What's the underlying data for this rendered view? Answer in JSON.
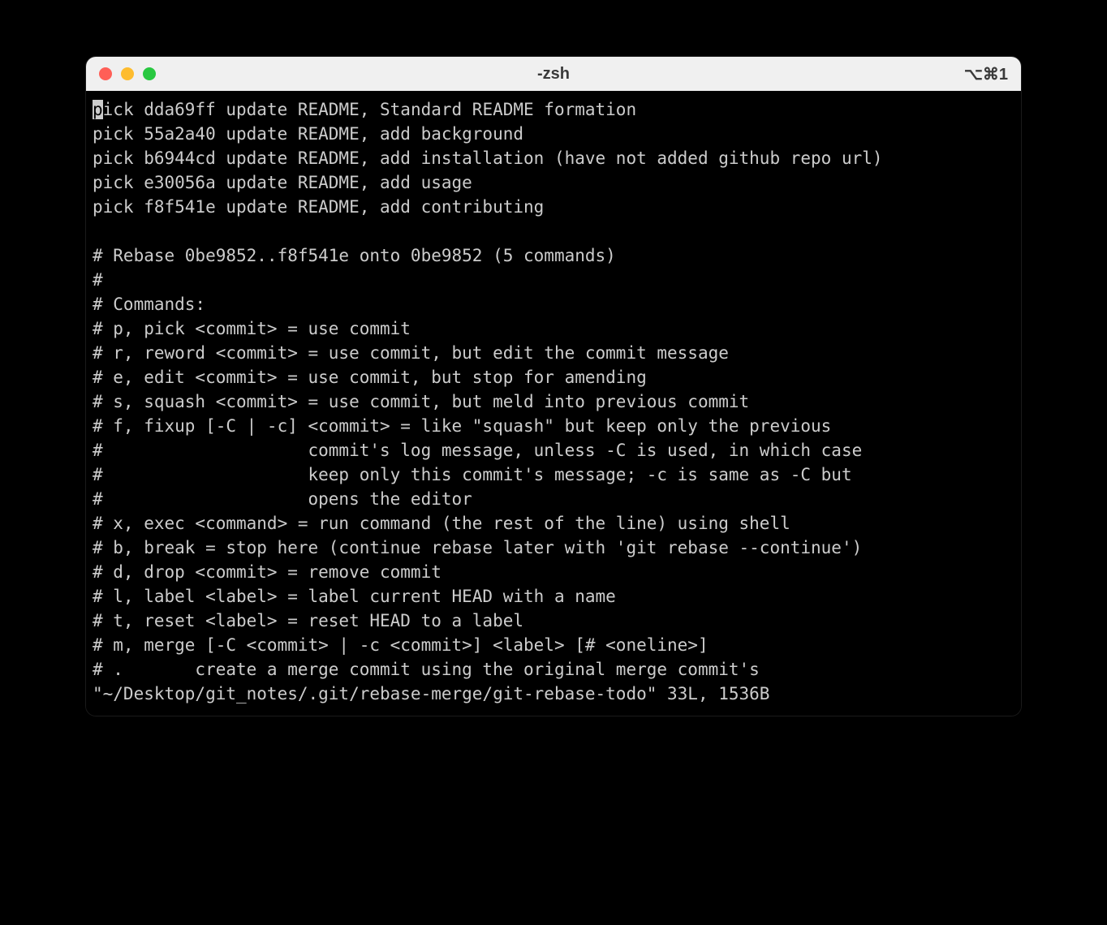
{
  "window": {
    "title": "-zsh",
    "shortcut": "⌥⌘1"
  },
  "terminal": {
    "lines": [
      "pick dda69ff update README, Standard README formation",
      "pick 55a2a40 update README, add background",
      "pick b6944cd update README, add installation (have not added github repo url)",
      "pick e30056a update README, add usage",
      "pick f8f541e update README, add contributing",
      "",
      "# Rebase 0be9852..f8f541e onto 0be9852 (5 commands)",
      "#",
      "# Commands:",
      "# p, pick <commit> = use commit",
      "# r, reword <commit> = use commit, but edit the commit message",
      "# e, edit <commit> = use commit, but stop for amending",
      "# s, squash <commit> = use commit, but meld into previous commit",
      "# f, fixup [-C | -c] <commit> = like \"squash\" but keep only the previous",
      "#                    commit's log message, unless -C is used, in which case",
      "#                    keep only this commit's message; -c is same as -C but",
      "#                    opens the editor",
      "# x, exec <command> = run command (the rest of the line) using shell",
      "# b, break = stop here (continue rebase later with 'git rebase --continue')",
      "# d, drop <commit> = remove commit",
      "# l, label <label> = label current HEAD with a name",
      "# t, reset <label> = reset HEAD to a label",
      "# m, merge [-C <commit> | -c <commit>] <label> [# <oneline>]",
      "# .       create a merge commit using the original merge commit's",
      "\"~/Desktop/git_notes/.git/rebase-merge/git-rebase-todo\" 33L, 1536B"
    ],
    "cursor": {
      "line": 0,
      "col": 0
    }
  }
}
